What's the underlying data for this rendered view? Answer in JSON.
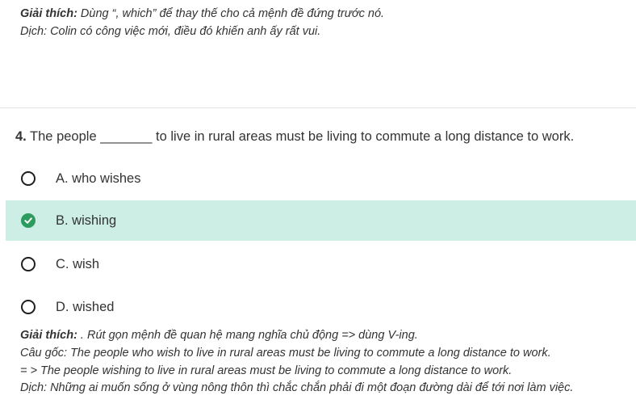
{
  "previous_explanation": {
    "label": "Giải thích:",
    "text": " Dùng “, which” để thay thế cho cả mệnh đề đứng trước nó.",
    "translation": "Dịch: Colin có công việc mới, điều đó khiến anh ấy rất vui."
  },
  "question": {
    "number": "4.",
    "text": " The people _______ to live in rural areas must be living to commute a long distance to work."
  },
  "options": [
    {
      "label": "A. who wishes",
      "state": "unselected"
    },
    {
      "label": "B. wishing",
      "state": "correct"
    },
    {
      "label": "C. wish",
      "state": "unselected"
    },
    {
      "label": "D. wished",
      "state": "unselected"
    }
  ],
  "explanation": {
    "label": "Giải thích:",
    "text": " . Rút gọn mệnh đề quan hệ mang nghĩa chủ động => dùng V-ing.",
    "original": "Câu gốc: The people who wish to live in rural areas must be living to commute a long distance to work.",
    "rewritten": "= > The people wishing to live in rural areas must be living to commute a long distance to work.",
    "translation": "Dịch: Những ai muốn sống ở vùng nông thôn thì chắc chắn phải đi một đoạn đường dài để tới nơi làm việc."
  },
  "colors": {
    "correct_background": "#cdeee4",
    "check_green": "#2e9b5e"
  }
}
